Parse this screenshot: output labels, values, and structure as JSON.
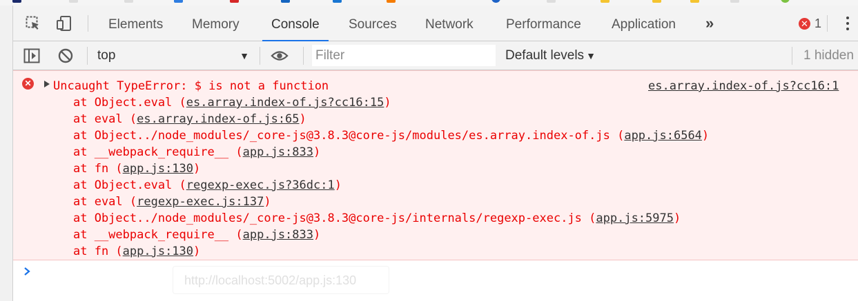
{
  "tabs": [
    {
      "label": "Elements",
      "active": false
    },
    {
      "label": "Memory",
      "active": false
    },
    {
      "label": "Console",
      "active": true
    },
    {
      "label": "Sources",
      "active": false
    },
    {
      "label": "Network",
      "active": false
    },
    {
      "label": "Performance",
      "active": false
    },
    {
      "label": "Application",
      "active": false
    }
  ],
  "more_tabs_label": "»",
  "error_count": "1",
  "toolbar": {
    "context": "top",
    "filter_placeholder": "Filter",
    "levels": "Default levels",
    "hidden": "1 hidden"
  },
  "error": {
    "message": "Uncaught TypeError: $ is not a function",
    "source": "es.array.index-of.js?cc16:1",
    "frames": [
      {
        "prefix": "at Object.eval (",
        "link": "es.array.index-of.js?cc16:15",
        "suffix": ")"
      },
      {
        "prefix": "at eval (",
        "link": "es.array.index-of.js:65",
        "suffix": ")"
      },
      {
        "prefix": "at Object../node_modules/_core-js@3.8.3@core-js/modules/es.array.index-of.js (",
        "link": "app.js:6564",
        "suffix": ")"
      },
      {
        "prefix": "at __webpack_require__ (",
        "link": "app.js:833",
        "suffix": ")"
      },
      {
        "prefix": "at fn (",
        "link": "app.js:130",
        "suffix": ")"
      },
      {
        "prefix": "at Object.eval (",
        "link": "regexp-exec.js?36dc:1",
        "suffix": ")"
      },
      {
        "prefix": "at eval (",
        "link": "regexp-exec.js:137",
        "suffix": ")"
      },
      {
        "prefix": "at Object../node_modules/_core-js@3.8.3@core-js/internals/regexp-exec.js (",
        "link": "app.js:5975",
        "suffix": ")"
      },
      {
        "prefix": "at __webpack_require__ (",
        "link": "app.js:833",
        "suffix": ")"
      },
      {
        "prefix": "at fn (",
        "link": "app.js:130",
        "suffix": ")"
      }
    ]
  },
  "tooltip": "http://localhost:5002/app.js:130",
  "colors": {
    "error_red": "#ea0000",
    "error_bg": "#fff0f0",
    "accent": "#1a73e8"
  }
}
